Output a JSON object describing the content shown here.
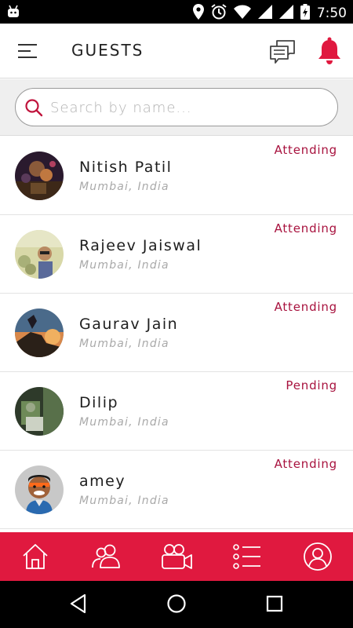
{
  "status_bar": {
    "time": "7:50"
  },
  "header": {
    "title": "GUESTS"
  },
  "search": {
    "placeholder": "Search by name..."
  },
  "guests": [
    {
      "name": "Nitish Patil",
      "location": "Mumbai, India",
      "status": "Attending"
    },
    {
      "name": "Rajeev Jaiswal",
      "location": "Mumbai, India",
      "status": "Attending"
    },
    {
      "name": "Gaurav Jain",
      "location": "Mumbai, India",
      "status": "Attending"
    },
    {
      "name": "Dilip",
      "location": "Mumbai, India",
      "status": "Pending"
    },
    {
      "name": "amey",
      "location": "Mumbai, India",
      "status": "Attending"
    }
  ],
  "bottom_nav": {
    "tabs": [
      "home-icon",
      "guests-icon",
      "video-camera-icon",
      "list-icon",
      "profile-icon"
    ]
  },
  "colors": {
    "accent": "#e0193f",
    "status_text": "#a8123e",
    "bell": "#e0193f"
  }
}
